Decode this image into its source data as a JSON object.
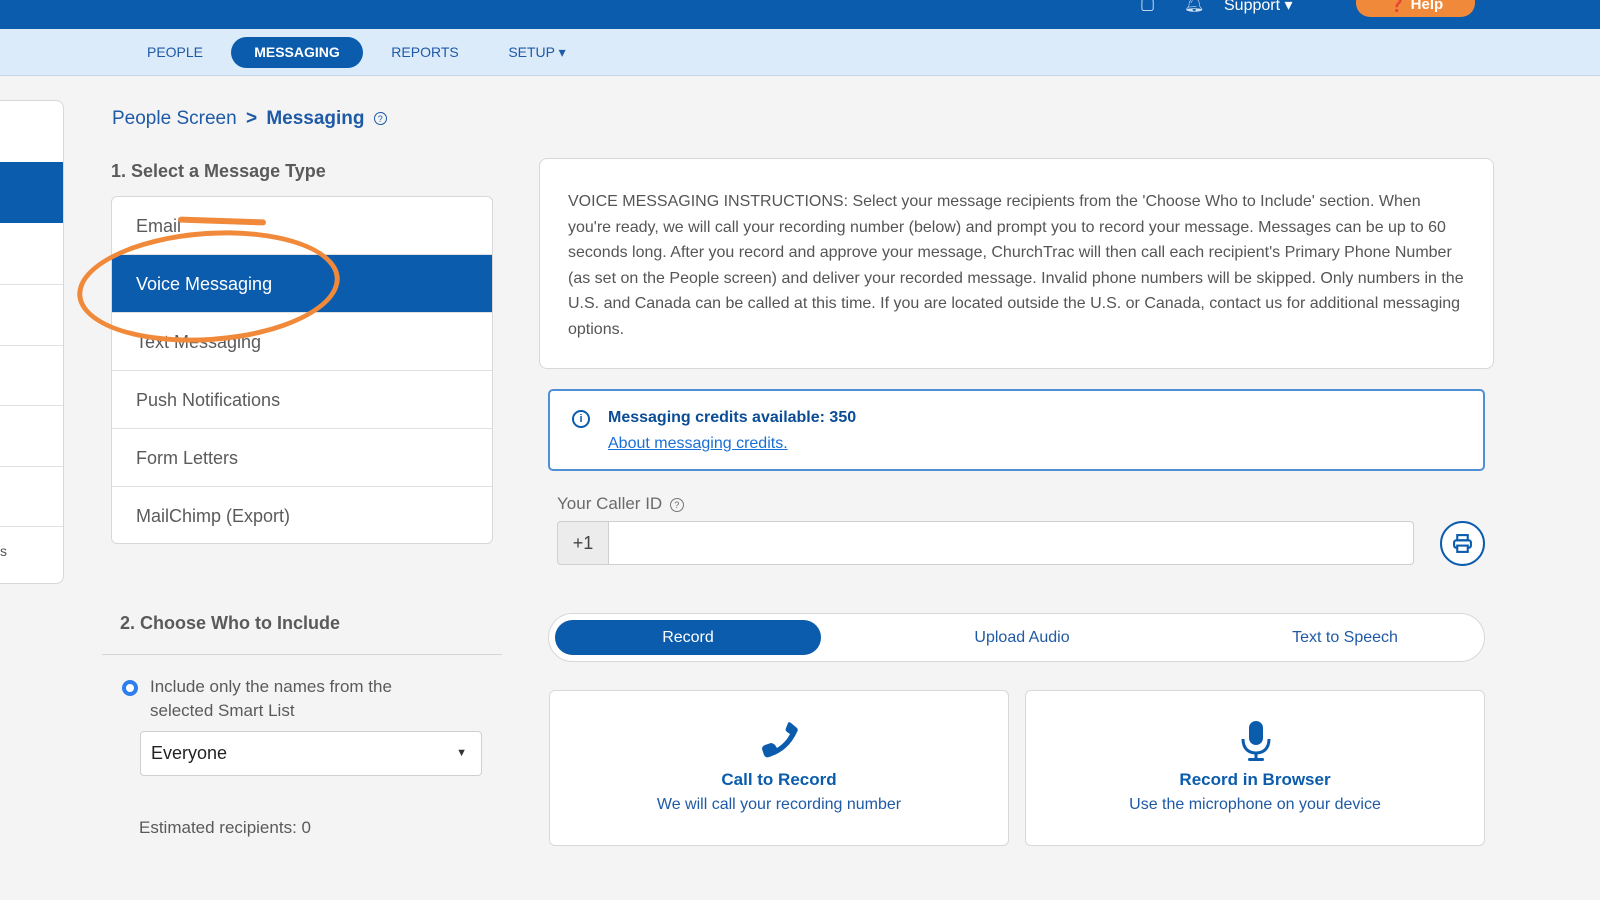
{
  "topbar": {
    "support_label": "Support ▾",
    "help_label": "❓ Help",
    "icons": [
      "document-icon",
      "bell-icon",
      "user-circle-icon"
    ]
  },
  "nav": {
    "items": [
      {
        "label": "PEOPLE",
        "active": false
      },
      {
        "label": "MESSAGING",
        "active": true
      },
      {
        "label": "REPORTS",
        "active": false
      },
      {
        "label": "SETUP ▾",
        "active": false
      }
    ]
  },
  "siderail": {
    "partial_text": "s"
  },
  "breadcrumb": {
    "parent": "People Screen",
    "separator": ">",
    "current": "Messaging",
    "help_glyph": "?"
  },
  "section1": {
    "title": "1. Select a Message Type",
    "types": [
      {
        "label": "Email",
        "active": false
      },
      {
        "label": "Voice Messaging",
        "active": true
      },
      {
        "label": "Text Messaging",
        "active": false
      },
      {
        "label": "Push Notifications",
        "active": false
      },
      {
        "label": "Form Letters",
        "active": false
      },
      {
        "label": "MailChimp (Export)",
        "active": false
      }
    ]
  },
  "section2": {
    "title": "2. Choose Who to Include",
    "radio_label": "Include only the names from the selected Smart List",
    "smart_list_value": "Everyone",
    "estimated": "Estimated recipients: 0"
  },
  "instructions": {
    "text": "VOICE MESSAGING INSTRUCTIONS: Select your message recipients from the 'Choose Who to Include' section. When you're ready, we will call your recording number (below) and prompt you to record your message. Messages can be up to 60 seconds long. After you record and approve your message, ChurchTrac will then call each recipient's Primary Phone Number (as set on the People screen) and deliver your recorded message. Invalid phone numbers will be skipped. Only numbers in the U.S. and Canada can be called at this time. If you are located outside the U.S. or Canada, contact us for additional messaging options."
  },
  "credits": {
    "text": "Messaging credits available: 350",
    "link": "About messaging credits."
  },
  "caller_id": {
    "label": "Your Caller ID",
    "help_glyph": "?",
    "prefix": "+1",
    "value": ""
  },
  "record_tabs": [
    {
      "label": "Record",
      "active": true
    },
    {
      "label": "Upload Audio",
      "active": false
    },
    {
      "label": "Text to Speech",
      "active": false
    }
  ],
  "options": [
    {
      "title": "Call to Record",
      "subtitle": "We will call your recording number",
      "icon": "phone-icon"
    },
    {
      "title": "Record in Browser",
      "subtitle": "Use the microphone on your device",
      "icon": "microphone-icon"
    }
  ],
  "colors": {
    "primary": "#0b5cad",
    "nav_bg": "#dbebfa",
    "accent_orange": "#f08a3a",
    "link": "#1a6fd6"
  }
}
